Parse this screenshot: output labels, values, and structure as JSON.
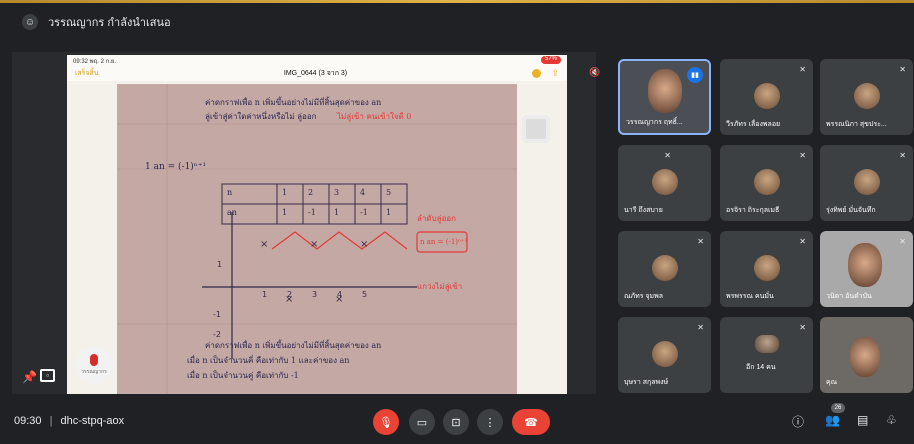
{
  "presenter_bar": {
    "icon": "presenter-icon",
    "text": "วรรณญากร กำลังนำเสนอ"
  },
  "phone": {
    "status_time": "09:32 พฤ. 2 ก.ย.",
    "battery": "57%",
    "back_label": "เสร็จสิ้น",
    "title": "IMG_0644 (3 จาก 3)"
  },
  "paper": {
    "heading_lines": [
      "ค่าดกราฟเพื่อ n เพิ่มขึ้นอย่างไม่มีที่สิ้นสุดค่าของ an",
      "ลู่เข้าสู่ค่าใดค่าหนึ่งหรือไม่ ลู่ออก"
    ],
    "red_note_top": "ไม่ลู่เข้า คนเข้าใจดี 0",
    "problem": "1  an = (-1)ⁿ⁺¹",
    "table_n": [
      "n",
      "1",
      "2",
      "3",
      "4",
      "5"
    ],
    "table_an": [
      "an",
      "1",
      "-1",
      "1",
      "-1",
      "1"
    ],
    "red_note_right": "ลำดับลู่ออก",
    "formula": "n  an = (-1)ⁿ⁺¹",
    "red_note_bottom": "แกว่งไม่ลู่เข้า",
    "bottom_lines": [
      "ค่าดกราฟเพื่อ n เพิ่มขึ้นอย่างไม่มีที่สิ้นสุดค่าของ an",
      "เมื่อ n เป็นจำนวนคี่ คือเท่ากับ 1 และค่าของ an",
      "เมื่อ n เป็นจำนวนคู่ คือเท่ากับ -1"
    ]
  },
  "owner_badge": "วรรณญากร",
  "tiles": [
    {
      "name": "วรรณญากร ฤทธิ์...",
      "type": "video",
      "speaking": true
    },
    {
      "name": "วีรภัทร เลื่องพลอย",
      "type": "avatar"
    },
    {
      "name": "พรรณนิภา สุขประ...",
      "type": "avatar"
    },
    {
      "name": "นารี ถึงสบาย",
      "type": "avatar"
    },
    {
      "name": "อรจิรา ถิระกุลเมธี",
      "type": "avatar"
    },
    {
      "name": "รุ่งทิพย์ มั่นจันทึก",
      "type": "avatar"
    },
    {
      "name": "ณภัทร จุมพล",
      "type": "avatar"
    },
    {
      "name": "พรพรรณ คนมั่น",
      "type": "avatar"
    },
    {
      "name": "วนิดา อันดำบัน",
      "type": "video"
    },
    {
      "name": "บุษรา สกุลพงษ์",
      "type": "avatar"
    },
    {
      "name": "อีก 14 คน",
      "type": "group"
    },
    {
      "name": "คุณ",
      "type": "video"
    }
  ],
  "bottom": {
    "time": "09:30",
    "separator": "|",
    "meeting_code": "dhc-stpq-aox",
    "people_count": "26"
  }
}
